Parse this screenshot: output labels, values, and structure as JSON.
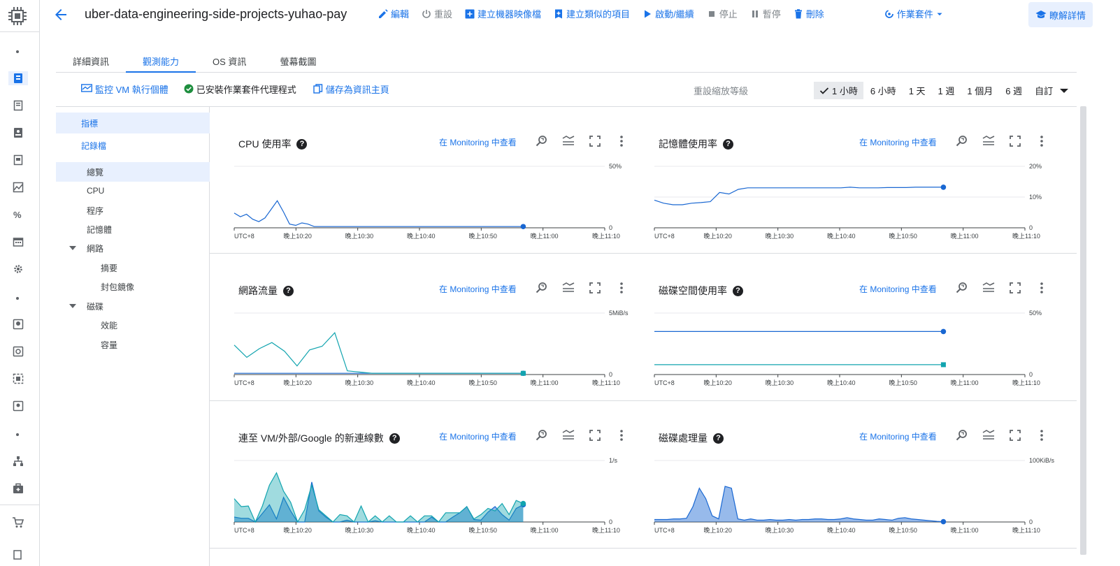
{
  "header": {
    "title": "uber-data-engineering-side-projects-yuhao-pay",
    "actions": [
      {
        "label": "編輯",
        "icon": "pencil-icon",
        "enabled": true
      },
      {
        "label": "重設",
        "icon": "power-icon",
        "enabled": false
      },
      {
        "label": "建立機器映像檔",
        "icon": "plus-box-icon",
        "enabled": true
      },
      {
        "label": "建立類似的項目",
        "icon": "copy-plus-icon",
        "enabled": true
      },
      {
        "label": "啟動/繼續",
        "icon": "play-icon",
        "enabled": true
      },
      {
        "label": "停止",
        "icon": "stop-icon",
        "enabled": false
      },
      {
        "label": "暫停",
        "icon": "pause-icon",
        "enabled": false
      },
      {
        "label": "刪除",
        "icon": "trash-icon",
        "enabled": true
      },
      {
        "label": "作業套件",
        "icon": "ops-suite-icon",
        "enabled": true
      }
    ],
    "learn_label": "瞭解詳情"
  },
  "tabs": [
    {
      "label": "詳細資訊",
      "active": false
    },
    {
      "label": "觀測能力",
      "active": true
    },
    {
      "label": "OS 資訊",
      "active": false
    },
    {
      "label": "螢幕截圖",
      "active": false
    }
  ],
  "subbar": {
    "monitor_label": "監控 VM 執行個體",
    "agent_label": "已安裝作業套件代理程式",
    "save_label": "儲存為資訊主頁",
    "reset_zoom_label": "重設縮放等級",
    "ranges": [
      {
        "label": "1 小時",
        "active": true
      },
      {
        "label": "6 小時",
        "active": false
      },
      {
        "label": "1 天",
        "active": false
      },
      {
        "label": "1 週",
        "active": false
      },
      {
        "label": "1 個月",
        "active": false
      },
      {
        "label": "6 週",
        "active": false
      },
      {
        "label": "自訂",
        "active": false
      }
    ]
  },
  "sidenav": {
    "items": [
      {
        "label": "指標",
        "style": "blue-sel"
      },
      {
        "label": "記錄檔",
        "style": "blue"
      },
      {
        "label": "總覽",
        "style": "sel"
      },
      {
        "label": "CPU",
        "style": ""
      },
      {
        "label": "程序",
        "style": ""
      },
      {
        "label": "記憶體",
        "style": ""
      },
      {
        "label": "網路",
        "style": "caret"
      },
      {
        "label": "摘要",
        "style": "sub"
      },
      {
        "label": "封包鏡像",
        "style": "sub"
      },
      {
        "label": "磁碟",
        "style": "caret"
      },
      {
        "label": "效能",
        "style": "sub"
      },
      {
        "label": "容量",
        "style": "sub"
      }
    ]
  },
  "panel_link_label": "在 Monitoring 中查看",
  "accent_color": "#1a73e8",
  "series_colors": [
    "#1967d2",
    "#12a4af"
  ],
  "chart_data": [
    {
      "type": "line",
      "title": "CPU 使用率",
      "x": [
        "UTC+8",
        "晚上10:20",
        "晚上10:30",
        "晚上10:40",
        "晚上10:50",
        "晚上11:00",
        "晚上11:10"
      ],
      "yticks": [
        "50%",
        "0"
      ],
      "ylim": [
        0,
        50
      ],
      "series": [
        {
          "values": [
            12,
            9,
            11,
            7,
            5,
            8,
            15,
            22,
            13,
            3,
            2,
            4,
            3,
            1,
            1,
            1,
            1,
            1,
            1,
            1,
            1,
            1,
            1,
            1,
            1,
            1,
            1,
            1,
            1,
            1,
            1,
            1,
            1,
            1,
            1,
            1,
            1,
            1,
            1,
            1,
            1,
            1,
            1,
            1,
            1,
            1,
            1,
            1
          ]
        }
      ]
    },
    {
      "type": "line",
      "title": "記憶體使用率",
      "x": [
        "UTC+8",
        "晚上10:20",
        "晚上10:30",
        "晚上10:40",
        "晚上10:50",
        "晚上11:00",
        "晚上11:10"
      ],
      "yticks": [
        "20%",
        "10%",
        "0"
      ],
      "ylim": [
        0,
        20
      ],
      "series": [
        {
          "values": [
            9,
            8,
            7.5,
            7.5,
            8,
            8.2,
            8.5,
            11.5,
            11,
            12.5,
            13,
            13,
            13,
            13,
            13,
            13,
            13,
            13,
            13,
            13,
            13,
            13.2,
            13,
            13,
            13,
            13.1,
            13.1,
            13.1,
            13.2,
            13.2,
            13.2,
            13.2
          ]
        }
      ]
    },
    {
      "type": "line",
      "title": "網路流量",
      "x": [
        "UTC+8",
        "晚上10:20",
        "晚上10:30",
        "晚上10:40",
        "晚上10:50",
        "晚上11:00",
        "晚上11:10"
      ],
      "yticks": [
        "5MiB/s",
        "0"
      ],
      "ylim": [
        0,
        5
      ],
      "series": [
        {
          "values": [
            0.1,
            0.1,
            0.1,
            0.1,
            0.1,
            0.1,
            0.1,
            0.1,
            0.1,
            0.1,
            0.1,
            0.1,
            0.1,
            0.1,
            0.1,
            0.1,
            0.1,
            0.1,
            0.1,
            0.1,
            0.1,
            0.1,
            0.1,
            0.1
          ]
        },
        {
          "values": [
            2.4,
            1.4,
            2.1,
            2.6,
            1.9,
            0.7,
            2.0,
            2.3,
            3.4,
            0.3,
            0.2,
            0.1,
            0.1,
            0.1,
            0.1,
            0.1,
            0.1,
            0.1,
            0.1,
            0.1,
            0.1,
            0.1,
            0.1,
            0.1
          ]
        }
      ]
    },
    {
      "type": "line",
      "title": "磁碟空間使用率",
      "x": [
        "UTC+8",
        "晚上10:20",
        "晚上10:30",
        "晚上10:40",
        "晚上10:50",
        "晚上11:00",
        "晚上11:10"
      ],
      "yticks": [
        "50%",
        "0"
      ],
      "ylim": [
        0,
        50
      ],
      "series": [
        {
          "values": [
            35,
            35,
            35,
            35,
            35,
            35,
            35,
            35,
            35,
            35,
            35,
            35
          ]
        },
        {
          "values": [
            8,
            8,
            8,
            8,
            8,
            8,
            8,
            8,
            8,
            8,
            8,
            8
          ]
        }
      ]
    },
    {
      "type": "area",
      "title": "連至 VM/外部/Google 的新連線數",
      "x": [
        "UTC+8",
        "晚上10:20",
        "晚上10:30",
        "晚上10:40",
        "晚上10:50",
        "晚上11:00",
        "晚上11:10"
      ],
      "yticks": [
        "1/s",
        "0"
      ],
      "ylim": [
        0,
        1
      ],
      "series": [
        {
          "values": [
            0.08,
            0.06,
            0.06,
            0,
            0.14,
            0.28,
            0.05,
            0.4,
            0.18,
            0,
            0,
            0.65,
            0.18,
            0.08,
            0,
            0,
            0.03,
            0,
            0,
            0,
            0.02,
            0,
            0,
            0,
            0,
            0,
            0,
            0,
            0.08,
            0,
            0,
            0.08,
            0.15,
            0.25,
            0.04,
            0.03,
            0.16,
            0.25,
            0.12,
            0.03,
            0.22,
            0.28
          ]
        },
        {
          "values": [
            0.38,
            0.25,
            0.26,
            0,
            0.26,
            0.6,
            0.8,
            0.5,
            0.32,
            0,
            0.2,
            0.6,
            0.2,
            0.1,
            0,
            0.12,
            0.1,
            0,
            0.26,
            0,
            0.1,
            0,
            0.1,
            0,
            0,
            0.1,
            0,
            0.1,
            0.1,
            0,
            0.15,
            0.15,
            0.15,
            0.25,
            0.05,
            0.12,
            0.22,
            0.18,
            0.3,
            0.12,
            0.35,
            0.3
          ]
        }
      ]
    },
    {
      "type": "area",
      "title": "磁碟處理量",
      "x": [
        "UTC+8",
        "晚上10:20",
        "晚上10:30",
        "晚上10:40",
        "晚上10:50",
        "晚上11:00",
        "晚上11:10"
      ],
      "yticks": [
        "100KiB/s",
        "0"
      ],
      "ylim": [
        0,
        100
      ],
      "series": [
        {
          "values": [
            4,
            4,
            4,
            5,
            5,
            6,
            25,
            55,
            38,
            10,
            5,
            58,
            55,
            5,
            3,
            5,
            3,
            3,
            4,
            3,
            3,
            4,
            3,
            4,
            4,
            5,
            5,
            4,
            4,
            5,
            7,
            5,
            4,
            3,
            3,
            5,
            4,
            3,
            6,
            7,
            5,
            4,
            3,
            2,
            1,
            0.5
          ]
        }
      ]
    }
  ]
}
